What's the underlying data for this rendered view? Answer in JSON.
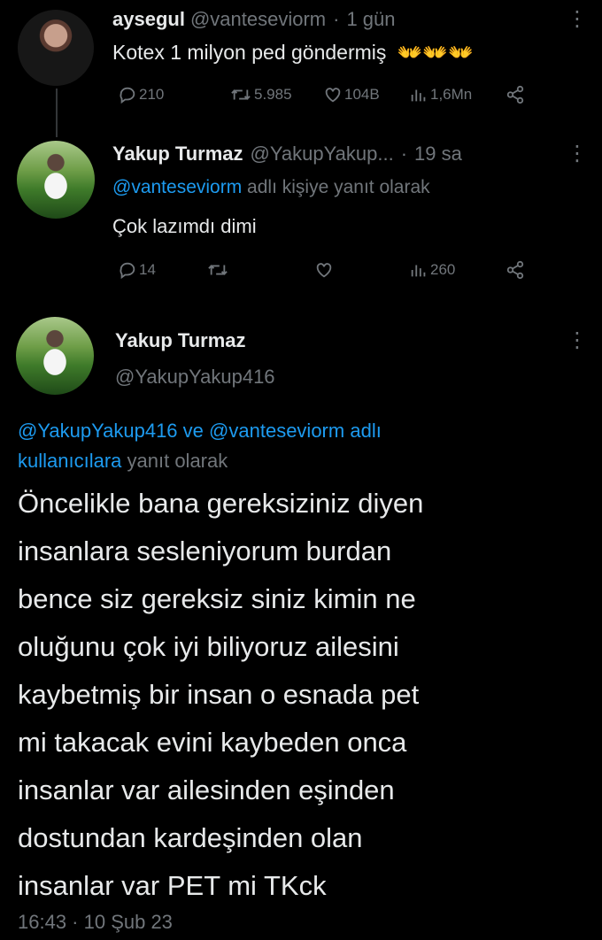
{
  "tweet1": {
    "display_name": "aysegul",
    "handle": "@vanteseviorm",
    "separator": "·",
    "time": "1 gün",
    "text": "Kotex 1 milyon ped göndermiş",
    "emoji": "👐👐👐",
    "reply_count": "210",
    "retweet_count": "5.985",
    "like_count": "104B",
    "view_count": "1,6Mn"
  },
  "tweet2": {
    "display_name": "Yakup Turmaz",
    "handle": "@YakupYakup...",
    "separator": "·",
    "time": "19 sa",
    "reply_to_handle": "@vanteseviorm",
    "reply_to_suffix": "adlı kişiye yanıt olarak",
    "text": "Çok lazımdı dimi",
    "reply_count": "14",
    "view_count": "260"
  },
  "tweet3": {
    "display_name": "Yakup Turmaz",
    "handle": "@YakupYakup416",
    "reply_line1_handle1": "@YakupYakup416",
    "reply_line1_ve": "ve",
    "reply_line1_handle2": "@vanteseviorm",
    "reply_line1_adli": "adlı",
    "reply_line2_link": "kullanıcılara",
    "reply_line2_suffix": "yanıt olarak",
    "body_lines": [
      "Öncelikle bana gereksiziniz diyen",
      "insanlara sesleniyorum burdan",
      "bence siz gereksiz siniz kimin ne",
      "oluğunu çok iyi biliyoruz ailesini",
      "kaybetmiş bir insan o esnada pet",
      "mi takacak evini kaybeden onca",
      "insanlar var ailesinden eşinden",
      "dostundan kardeşinden olan",
      "insanlar var PET mi TKck"
    ],
    "timestamp": "16:43 · 10 Şub 23"
  },
  "icons": {
    "reply": "reply-icon",
    "retweet": "retweet-icon",
    "like": "heart-icon",
    "views": "views-icon",
    "share": "share-icon",
    "more": "more-icon"
  },
  "colors": {
    "background": "#000000",
    "text": "#e7e9ea",
    "muted": "#71767b",
    "link": "#1d9bf0"
  }
}
